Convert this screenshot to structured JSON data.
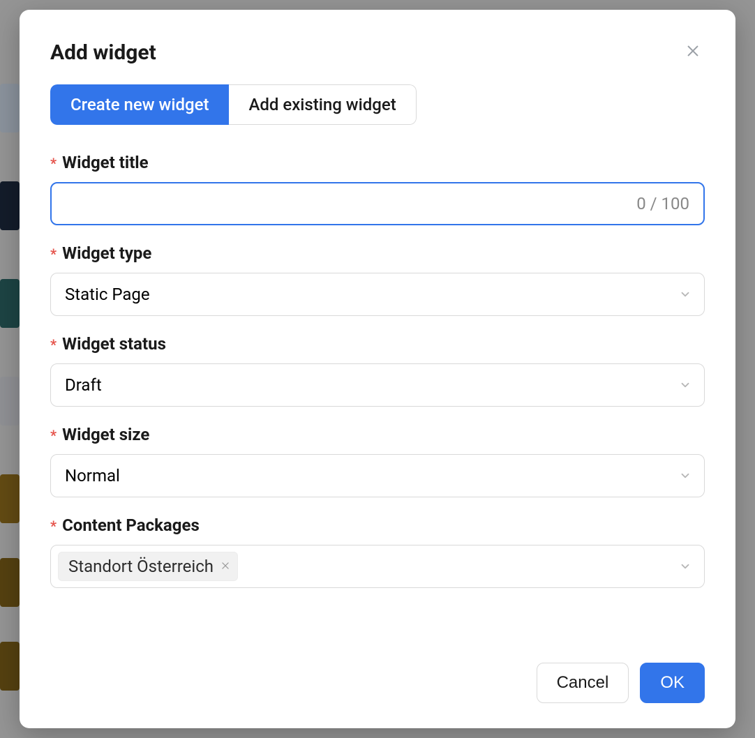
{
  "modal": {
    "title": "Add widget",
    "tabs": [
      {
        "label": "Create new widget",
        "active": true
      },
      {
        "label": "Add existing widget",
        "active": false
      }
    ],
    "fields": {
      "title": {
        "label": "Widget title",
        "required": true,
        "value": "",
        "counter": "0 / 100",
        "max": 100
      },
      "type": {
        "label": "Widget type",
        "required": true,
        "value": "Static Page"
      },
      "status": {
        "label": "Widget status",
        "required": true,
        "value": "Draft"
      },
      "size": {
        "label": "Widget size",
        "required": true,
        "value": "Normal"
      },
      "packages": {
        "label": "Content Packages",
        "required": true,
        "tags": [
          {
            "label": "Standort Österreich"
          }
        ]
      }
    },
    "footer": {
      "cancel": "Cancel",
      "ok": "OK"
    },
    "required_mark": "*"
  }
}
